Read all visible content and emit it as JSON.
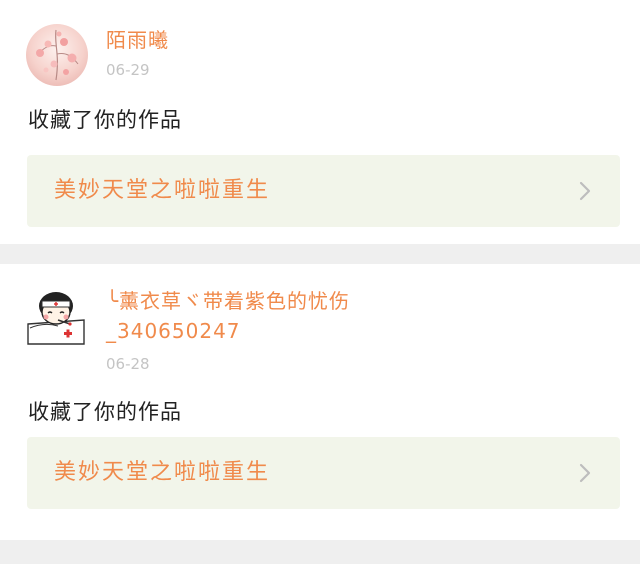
{
  "notifications": [
    {
      "user": {
        "name": "陌雨曦"
      },
      "date": "06-29",
      "action": "收藏了你的作品",
      "work": {
        "title": "美妙天堂之啦啦重生"
      }
    },
    {
      "user": {
        "name_line1": "╰薰衣草ヾ带着紫色的忧伤",
        "name_line2": "_340650247"
      },
      "date": "06-28",
      "action": "收藏了你的作品",
      "work": {
        "title": "美妙天堂之啦啦重生"
      }
    }
  ],
  "colors": {
    "accent": "#f08a4b",
    "date": "#c4c4c4",
    "card_bg": "#f2f5ea",
    "separator": "#efefef"
  },
  "icons": {
    "avatar_1": "avatar-pink-blossom",
    "avatar_2": "avatar-cartoon-sick-child",
    "chevron": "chevron-right-icon"
  }
}
